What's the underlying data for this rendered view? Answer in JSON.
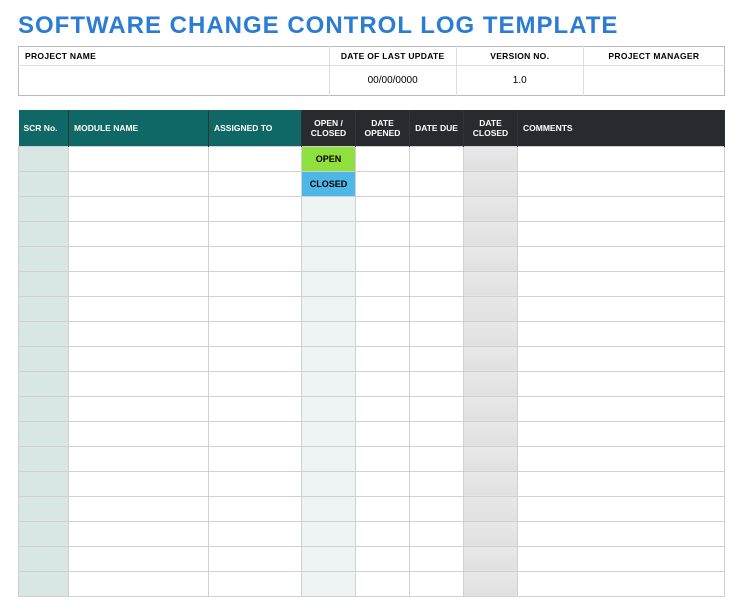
{
  "title": "SOFTWARE CHANGE CONTROL LOG TEMPLATE",
  "meta": {
    "headers": {
      "project_name": "PROJECT NAME",
      "date_last_update": "DATE OF LAST UPDATE",
      "version_no": "VERSION NO.",
      "project_manager": "PROJECT MANAGER"
    },
    "values": {
      "project_name": "",
      "date_last_update": "00/00/0000",
      "version_no": "1.0",
      "project_manager": ""
    }
  },
  "columns": {
    "scr_no": "SCR No.",
    "module_name": "MODULE NAME",
    "assigned_to": "ASSIGNED TO",
    "open_closed": "OPEN / CLOSED",
    "date_opened": "DATE OPENED",
    "date_due": "DATE DUE",
    "date_closed": "DATE CLOSED",
    "comments": "COMMENTS"
  },
  "rows": [
    {
      "scr_no": "",
      "module_name": "",
      "assigned_to": "",
      "status": "OPEN",
      "date_opened": "",
      "date_due": "",
      "date_closed": "",
      "comments": ""
    },
    {
      "scr_no": "",
      "module_name": "",
      "assigned_to": "",
      "status": "CLOSED",
      "date_opened": "",
      "date_due": "",
      "date_closed": "",
      "comments": ""
    },
    {
      "scr_no": "",
      "module_name": "",
      "assigned_to": "",
      "status": "",
      "date_opened": "",
      "date_due": "",
      "date_closed": "",
      "comments": ""
    },
    {
      "scr_no": "",
      "module_name": "",
      "assigned_to": "",
      "status": "",
      "date_opened": "",
      "date_due": "",
      "date_closed": "",
      "comments": ""
    },
    {
      "scr_no": "",
      "module_name": "",
      "assigned_to": "",
      "status": "",
      "date_opened": "",
      "date_due": "",
      "date_closed": "",
      "comments": ""
    },
    {
      "scr_no": "",
      "module_name": "",
      "assigned_to": "",
      "status": "",
      "date_opened": "",
      "date_due": "",
      "date_closed": "",
      "comments": ""
    },
    {
      "scr_no": "",
      "module_name": "",
      "assigned_to": "",
      "status": "",
      "date_opened": "",
      "date_due": "",
      "date_closed": "",
      "comments": ""
    },
    {
      "scr_no": "",
      "module_name": "",
      "assigned_to": "",
      "status": "",
      "date_opened": "",
      "date_due": "",
      "date_closed": "",
      "comments": ""
    },
    {
      "scr_no": "",
      "module_name": "",
      "assigned_to": "",
      "status": "",
      "date_opened": "",
      "date_due": "",
      "date_closed": "",
      "comments": ""
    },
    {
      "scr_no": "",
      "module_name": "",
      "assigned_to": "",
      "status": "",
      "date_opened": "",
      "date_due": "",
      "date_closed": "",
      "comments": ""
    },
    {
      "scr_no": "",
      "module_name": "",
      "assigned_to": "",
      "status": "",
      "date_opened": "",
      "date_due": "",
      "date_closed": "",
      "comments": ""
    },
    {
      "scr_no": "",
      "module_name": "",
      "assigned_to": "",
      "status": "",
      "date_opened": "",
      "date_due": "",
      "date_closed": "",
      "comments": ""
    },
    {
      "scr_no": "",
      "module_name": "",
      "assigned_to": "",
      "status": "",
      "date_opened": "",
      "date_due": "",
      "date_closed": "",
      "comments": ""
    },
    {
      "scr_no": "",
      "module_name": "",
      "assigned_to": "",
      "status": "",
      "date_opened": "",
      "date_due": "",
      "date_closed": "",
      "comments": ""
    },
    {
      "scr_no": "",
      "module_name": "",
      "assigned_to": "",
      "status": "",
      "date_opened": "",
      "date_due": "",
      "date_closed": "",
      "comments": ""
    },
    {
      "scr_no": "",
      "module_name": "",
      "assigned_to": "",
      "status": "",
      "date_opened": "",
      "date_due": "",
      "date_closed": "",
      "comments": ""
    },
    {
      "scr_no": "",
      "module_name": "",
      "assigned_to": "",
      "status": "",
      "date_opened": "",
      "date_due": "",
      "date_closed": "",
      "comments": ""
    },
    {
      "scr_no": "",
      "module_name": "",
      "assigned_to": "",
      "status": "",
      "date_opened": "",
      "date_due": "",
      "date_closed": "",
      "comments": ""
    }
  ]
}
